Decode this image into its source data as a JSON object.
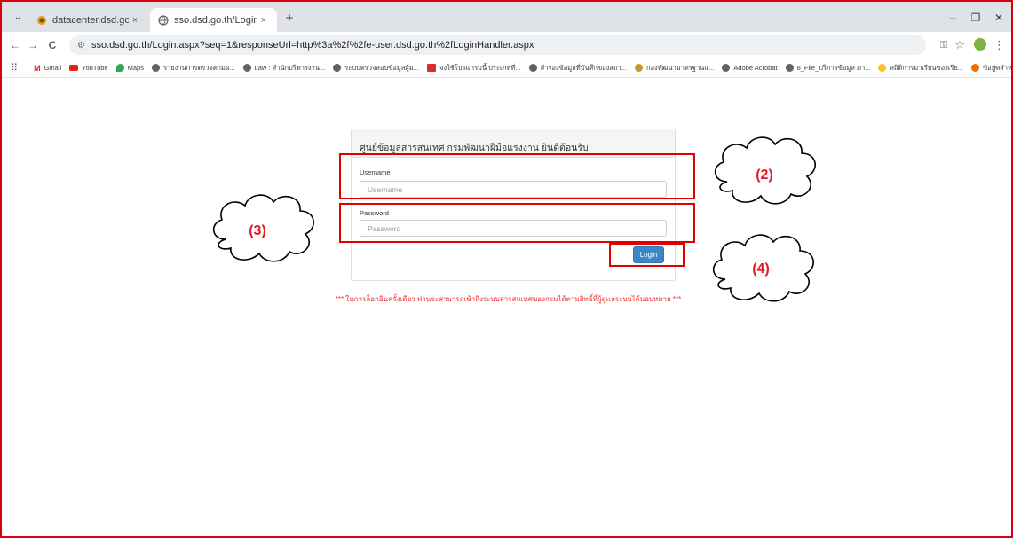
{
  "tabs": [
    {
      "title": "datacenter.dsd.go.th |",
      "favicon": "crest-icon",
      "close": "×"
    },
    {
      "title": "sso.dsd.go.th/Login.aspx?seq=",
      "favicon": "globe-icon",
      "close": "×"
    }
  ],
  "tab_menu": "⌄",
  "new_tab": "+",
  "window_controls": {
    "minimize": "–",
    "restore": "❐",
    "close": "✕"
  },
  "toolbar": {
    "back": "←",
    "forward": "→",
    "reload": "C",
    "url": "sso.dsd.go.th/Login.aspx?seq=1&responseUrl=http%3a%2f%2fe-user.dsd.go.th%2fLoginHandler.aspx",
    "site_info": "⚙",
    "password_key": "⚿",
    "star": "☆",
    "menu": "⋮"
  },
  "bookmarks": {
    "apps": "⠿",
    "items": [
      {
        "label": "Gmail",
        "icon": "gmail"
      },
      {
        "label": "YouTube",
        "icon": "yt"
      },
      {
        "label": "Maps",
        "icon": "maps"
      },
      {
        "label": "รายงานการตรวจตามผ...",
        "icon": "globe"
      },
      {
        "label": "Law : สำนักบริหารงาน...",
        "icon": "globe"
      },
      {
        "label": "ระบบตรวจสอบข้อมูลผู้ม...",
        "icon": "globe"
      },
      {
        "label": "จงใช้โปรแกรมนี้ ประเภทที่...",
        "icon": "red"
      },
      {
        "label": "สำรองข้อมูลที่บันทึกของสถา...",
        "icon": "globe"
      },
      {
        "label": "กองพัฒนามาตรฐานแ...",
        "icon": "crest"
      },
      {
        "label": "Adobe Acrobat",
        "icon": "globe"
      },
      {
        "label": "8_File_บริการข้อมูล ภา...",
        "icon": "globe"
      },
      {
        "label": "สถิติการมาเรียนของเรีย...",
        "icon": "yellow"
      },
      {
        "label": "ข้อมูลสำหรับผู้ปฏิบัติงาน...",
        "icon": "orange"
      }
    ],
    "more": "»"
  },
  "login": {
    "heading": "ศูนย์ข้อมูลสารสนเทศ กรมพัฒนาฝีมือแรงงาน ยินดีต้อนรับ",
    "username_label": "Username",
    "username_placeholder": "Username",
    "password_label": "Password",
    "password_placeholder": "Password",
    "button": "Login"
  },
  "notice": "*** ในการล็อกอินครั้งเดียว ท่านจะสามารถเข้าถึงระบบสารสนเทศของกรมได้ตามสิทธิ์ที่ผู้ดูแลระบบได้มอบหมาย ***",
  "annotations": [
    "(2)",
    "(3)",
    "(4)"
  ],
  "colors": {
    "annotation": "#e21c24",
    "login_button": "#3a87c8",
    "notice": "#e8302b"
  }
}
